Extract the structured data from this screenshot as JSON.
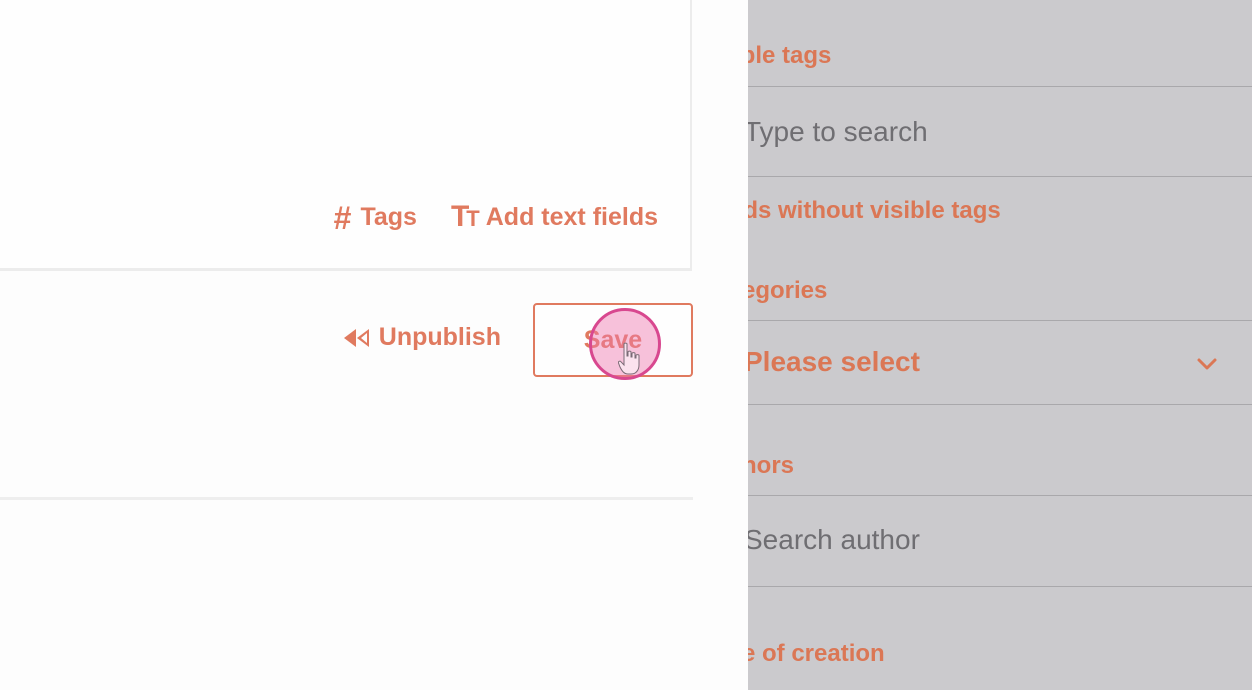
{
  "editor": {
    "tags_label": "Tags",
    "add_text_fields_label": "Add text fields",
    "unpublish_label": "Unpublish",
    "save_label": "Save"
  },
  "filter_panel": {
    "visible_tags_heading": "ible tags",
    "tag_search_placeholder": "Type to search",
    "records_without_tags_label": "rds without visible tags",
    "categories_heading": "tegories",
    "categories_select_value": "Please select",
    "authors_heading": "thors",
    "author_search_placeholder": "Search author",
    "date_heading": "te of creation"
  },
  "colors": {
    "accent": "#e07a5f",
    "panel_background": "#cbcacd",
    "cursor_highlight": "#d8488f"
  },
  "icons": {
    "tags": "hash-icon",
    "text_fields": "text-size-icon",
    "unpublish": "rewind-icon",
    "dropdown": "chevron-down-icon",
    "cursor": "hand-pointer-icon"
  }
}
